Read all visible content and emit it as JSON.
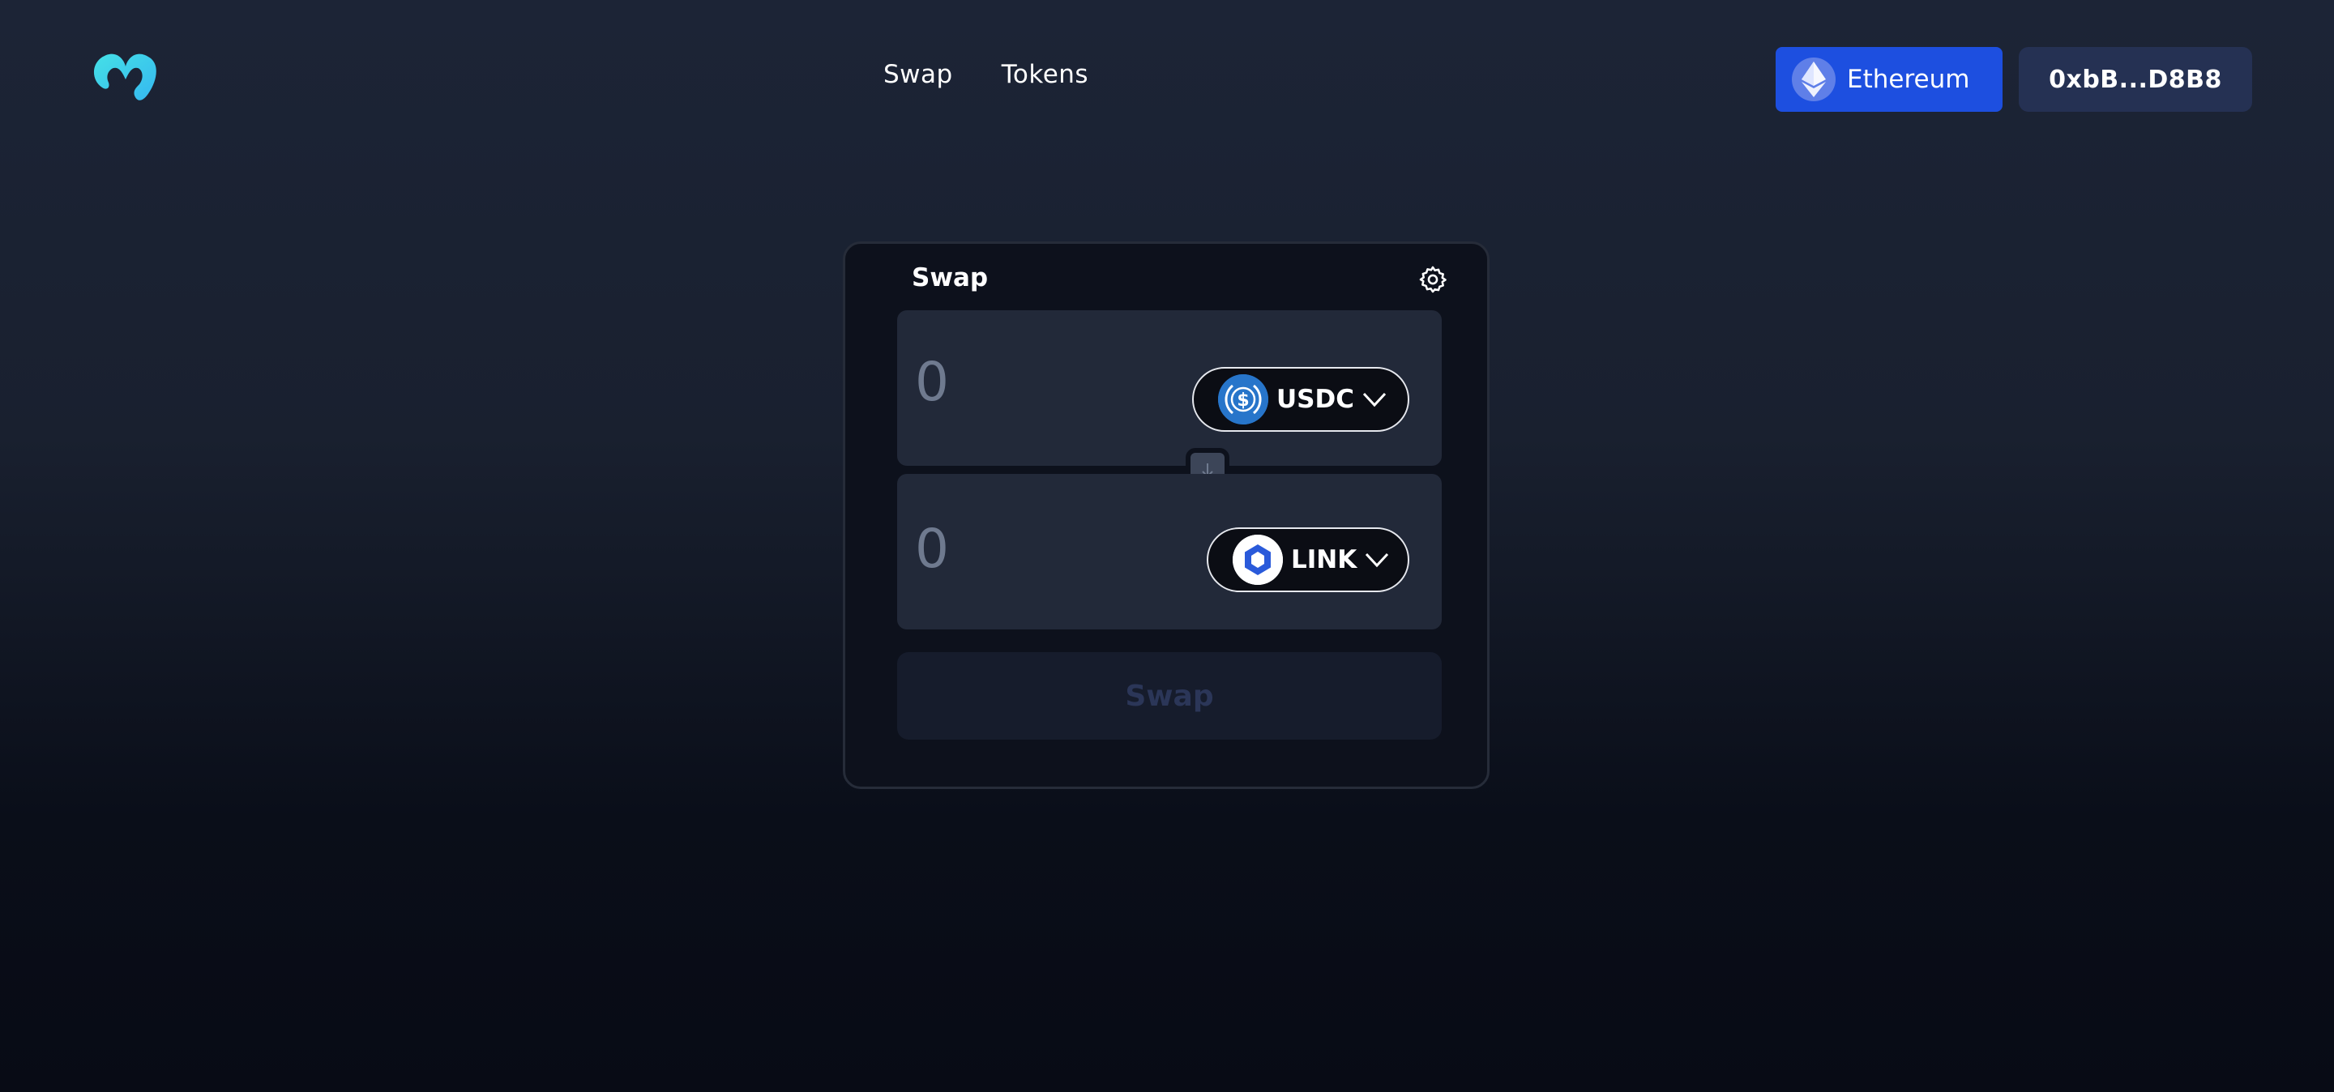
{
  "nav": {
    "links": [
      "Swap",
      "Tokens"
    ]
  },
  "network_button": {
    "label": "Ethereum",
    "icon": "ethereum-icon",
    "color": "#1d4fe0"
  },
  "account_button": {
    "label": "0xbB...D8B8"
  },
  "swap_card": {
    "title": "Swap",
    "from": {
      "amount_placeholder": "0",
      "token": "USDC",
      "icon": "usdc-icon"
    },
    "to": {
      "amount_placeholder": "0",
      "token": "LINK",
      "icon": "link-icon"
    },
    "submit_label": "Swap"
  },
  "colors": {
    "accent": "#1d4fe0",
    "logo": "#3fd3e6"
  }
}
